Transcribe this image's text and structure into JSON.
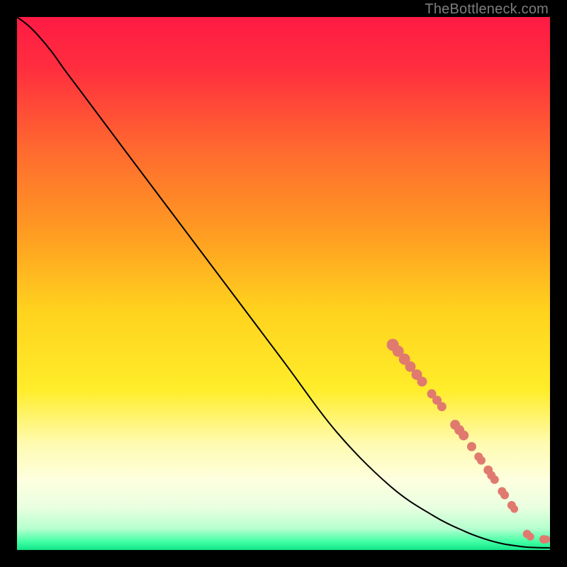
{
  "watermark": "TheBottleneck.com",
  "chart_data": {
    "type": "line",
    "title": "",
    "xlabel": "",
    "ylabel": "",
    "xlim": [
      0,
      100
    ],
    "ylim": [
      0,
      100
    ],
    "background_gradient": {
      "stops": [
        {
          "offset": 0.0,
          "color": "#ff1a44"
        },
        {
          "offset": 0.1,
          "color": "#ff2f3e"
        },
        {
          "offset": 0.25,
          "color": "#ff6a2f"
        },
        {
          "offset": 0.4,
          "color": "#ff9a22"
        },
        {
          "offset": 0.55,
          "color": "#ffd21e"
        },
        {
          "offset": 0.7,
          "color": "#ffed2a"
        },
        {
          "offset": 0.8,
          "color": "#fffbb0"
        },
        {
          "offset": 0.87,
          "color": "#fdffe0"
        },
        {
          "offset": 0.92,
          "color": "#e9ffe0"
        },
        {
          "offset": 0.96,
          "color": "#b6ffcf"
        },
        {
          "offset": 0.985,
          "color": "#3fffa3"
        },
        {
          "offset": 1.0,
          "color": "#13e489"
        }
      ]
    },
    "series": [
      {
        "name": "curve",
        "x": [
          0.0,
          2.0,
          4.0,
          6.5,
          9.0,
          12.0,
          20.0,
          30.0,
          40.0,
          50.0,
          60.0,
          70.0,
          78.0,
          84.0,
          88.0,
          91.0,
          93.5,
          95.5,
          97.5,
          100.0
        ],
        "y": [
          100.0,
          98.5,
          96.5,
          93.5,
          90.0,
          86.0,
          75.3,
          62.0,
          48.7,
          35.4,
          22.1,
          12.0,
          6.5,
          3.5,
          2.0,
          1.2,
          0.8,
          0.55,
          0.45,
          0.4
        ]
      }
    ],
    "markers": {
      "color": "#e07a6f",
      "radius_range": [
        5,
        9
      ],
      "points": [
        {
          "x": 70.5,
          "y": 38.5,
          "r": 8.5
        },
        {
          "x": 71.5,
          "y": 37.3,
          "r": 8.0
        },
        {
          "x": 72.7,
          "y": 35.8,
          "r": 8.0
        },
        {
          "x": 73.8,
          "y": 34.4,
          "r": 7.5
        },
        {
          "x": 75.0,
          "y": 32.9,
          "r": 7.5
        },
        {
          "x": 76.0,
          "y": 31.6,
          "r": 7.0
        },
        {
          "x": 77.8,
          "y": 29.3,
          "r": 6.5
        },
        {
          "x": 78.8,
          "y": 28.1,
          "r": 6.5
        },
        {
          "x": 79.7,
          "y": 26.9,
          "r": 6.5
        },
        {
          "x": 82.2,
          "y": 23.5,
          "r": 7.0
        },
        {
          "x": 83.0,
          "y": 22.5,
          "r": 7.0
        },
        {
          "x": 83.8,
          "y": 21.5,
          "r": 7.0
        },
        {
          "x": 85.3,
          "y": 19.4,
          "r": 6.5
        },
        {
          "x": 86.6,
          "y": 17.5,
          "r": 6.0
        },
        {
          "x": 87.1,
          "y": 16.8,
          "r": 6.0
        },
        {
          "x": 88.4,
          "y": 15.0,
          "r": 6.5
        },
        {
          "x": 89.0,
          "y": 14.0,
          "r": 6.0
        },
        {
          "x": 89.6,
          "y": 13.2,
          "r": 6.0
        },
        {
          "x": 91.0,
          "y": 11.0,
          "r": 6.0
        },
        {
          "x": 91.5,
          "y": 10.3,
          "r": 6.0
        },
        {
          "x": 92.8,
          "y": 8.4,
          "r": 6.0
        },
        {
          "x": 93.3,
          "y": 7.7,
          "r": 5.5
        },
        {
          "x": 95.7,
          "y": 3.0,
          "r": 6.0
        },
        {
          "x": 96.3,
          "y": 2.5,
          "r": 5.5
        },
        {
          "x": 98.8,
          "y": 2.0,
          "r": 6.0
        },
        {
          "x": 99.3,
          "y": 2.0,
          "r": 5.5
        }
      ]
    }
  }
}
